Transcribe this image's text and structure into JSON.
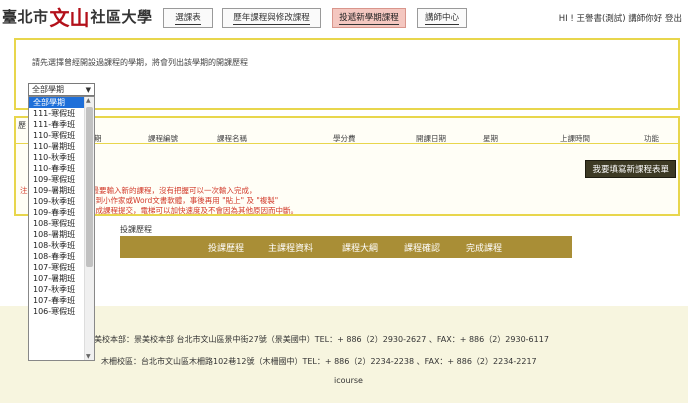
{
  "header": {
    "logo_left": "臺北市",
    "logo_mark": "文山",
    "logo_right": "社區大學",
    "nav": [
      {
        "label": "選課表"
      },
      {
        "label": "歷年課程與修改課程"
      },
      {
        "label": "投遞新學期課程"
      },
      {
        "label": "講師中心"
      }
    ],
    "user": "HI ! 王譽書(測試) 講師你好 登出"
  },
  "semester": {
    "instruction": "請先選擇曾經開設過課程的學期，將會列出該學期的開課歷程",
    "selected": "全部學期",
    "options": [
      "全部學期",
      "111-寒假班",
      "111-春季班",
      "110-寒假班",
      "110-暑期班",
      "110-秋季班",
      "110-春季班",
      "109-寒假班",
      "109-暑期班",
      "109-秋季班",
      "109-春季班",
      "108-寒假班",
      "108-暑期班",
      "108-秋季班",
      "108-春季班",
      "107-寒假班",
      "107-暑期班",
      "107-秋季班",
      "107-春季班",
      "106-寒假班"
    ]
  },
  "list": {
    "title": "歷",
    "columns": [
      "期",
      "課程編號",
      "課程名稱",
      "學分費",
      "開課日期",
      "星期",
      "上課時間",
      "功能"
    ],
    "new_course_button": "我要填寫新課程表單",
    "notes": [
      "注",
      "最要輸入新的課程，沒有把握可以一次輸入完成，",
      "入到小作家或Word文書軟體，事後再用 \"貼上\" 及 \"複製\"",
      "完成課程提交，電梯可以加快速度及不會因為其他原因而中斷。"
    ]
  },
  "tabs": {
    "title": "投課歷程",
    "items": [
      "投課歷程",
      "主課程資料",
      "課程大綱",
      "課程確認",
      "完成課程"
    ]
  },
  "footer": {
    "line1": "美校本部：景美校本部 台北市文山區景中街27號（景美國中）TEL：+ 886（2）2930-2627 、FAX：+ 886（2）2930-6117",
    "line2": "木柵校區：台北市文山區木柵路102巷12號（木柵國中）TEL：+ 886（2）2234-2238 、FAX：+ 886（2）2234-2217",
    "line3": "icourse"
  }
}
